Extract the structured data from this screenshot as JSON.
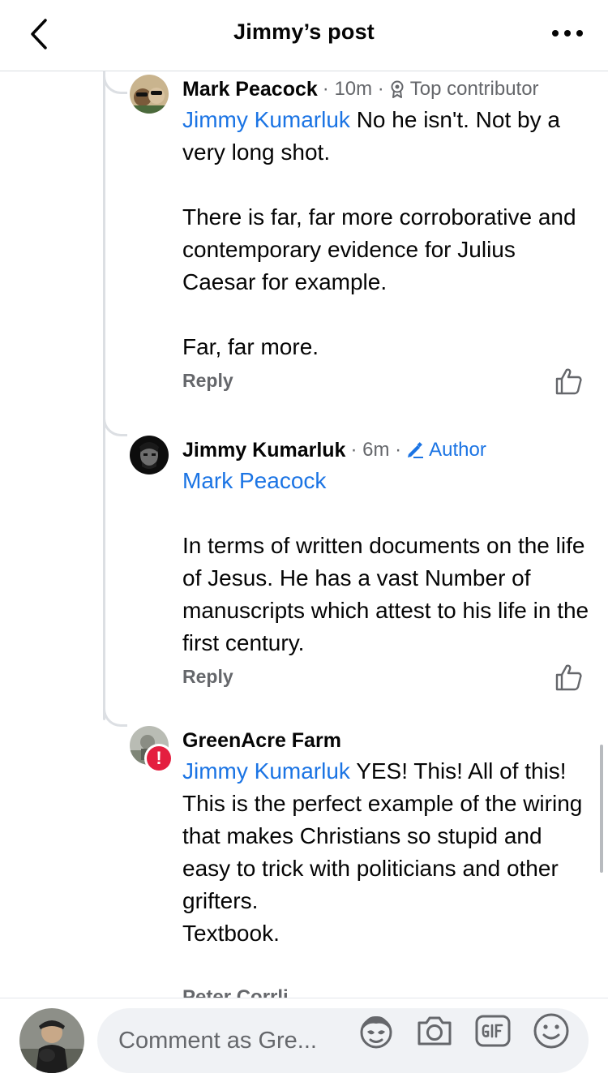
{
  "header": {
    "title": "Jimmy’s post"
  },
  "comments": [
    {
      "author": "Mark Peacock",
      "time": "· 10m ·",
      "badge": "Top contributor",
      "mention": "Jimmy Kumarluk",
      "text": " No he isn't. Not by a very long shot.\n\nThere is far, far more corroborative and contemporary evidence for Julius Caesar for example.\n\nFar, far more.",
      "reply": "Reply"
    },
    {
      "author": "Jimmy Kumarluk",
      "time": "· 6m ·",
      "badge": "Author",
      "mention": "Mark Peacock",
      "text": "\n\nIn terms of written documents on the life of Jesus. He has a vast Number of manuscripts which attest to his life in the first century.",
      "reply": "Reply"
    },
    {
      "author": "GreenAcre Farm",
      "mention": "Jimmy Kumarluk",
      "text": " YES! This! All of this!\nThis is the perfect example of the wiring that makes Christians so stupid and easy to trick with politicians and other grifters.\nTextbook.",
      "warning": "!"
    }
  ],
  "next_comment_author": "Peter Corrli",
  "composer": {
    "placeholder": "Comment as Gre...",
    "icons": [
      "avatar-sticker-icon",
      "camera-icon",
      "gif-icon",
      "emoji-icon"
    ]
  },
  "colors": {
    "link": "#1b74e4",
    "meta": "#65676b",
    "warning": "#e41e3f"
  }
}
